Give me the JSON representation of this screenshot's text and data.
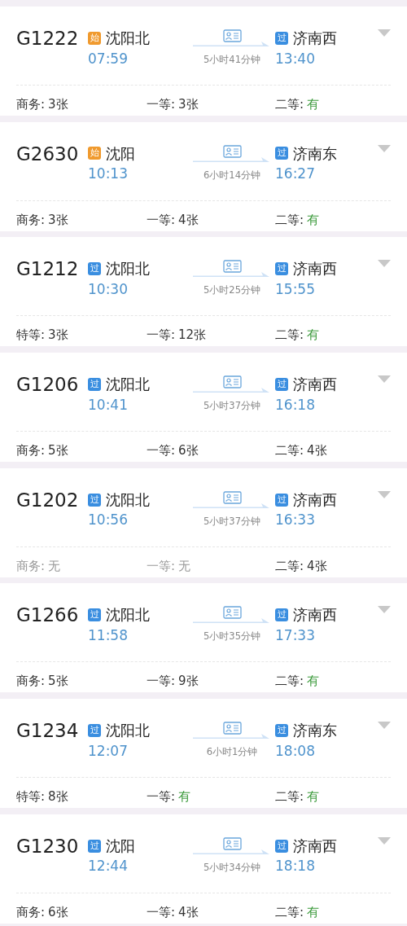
{
  "trains": [
    {
      "number": "G1222",
      "from": {
        "kind": "start",
        "badge": "始",
        "station": "沈阳北",
        "time": "07:59"
      },
      "duration": "5小时41分钟",
      "to": {
        "kind": "pass",
        "badge": "过",
        "station": "济南西",
        "time": "13:40"
      },
      "seats": [
        {
          "label": "商务:",
          "value": "3张",
          "kind": "count"
        },
        {
          "label": "一等:",
          "value": "3张",
          "kind": "count"
        },
        {
          "label": "二等:",
          "value": "有",
          "kind": "plenty"
        }
      ]
    },
    {
      "number": "G2630",
      "from": {
        "kind": "start",
        "badge": "始",
        "station": "沈阳",
        "time": "10:13"
      },
      "duration": "6小时14分钟",
      "to": {
        "kind": "pass",
        "badge": "过",
        "station": "济南东",
        "time": "16:27"
      },
      "seats": [
        {
          "label": "商务:",
          "value": "3张",
          "kind": "count"
        },
        {
          "label": "一等:",
          "value": "4张",
          "kind": "count"
        },
        {
          "label": "二等:",
          "value": "有",
          "kind": "plenty"
        }
      ]
    },
    {
      "number": "G1212",
      "from": {
        "kind": "pass",
        "badge": "过",
        "station": "沈阳北",
        "time": "10:30"
      },
      "duration": "5小时25分钟",
      "to": {
        "kind": "pass",
        "badge": "过",
        "station": "济南西",
        "time": "15:55"
      },
      "seats": [
        {
          "label": "特等:",
          "value": "3张",
          "kind": "count"
        },
        {
          "label": "一等:",
          "value": "12张",
          "kind": "count"
        },
        {
          "label": "二等:",
          "value": "有",
          "kind": "plenty"
        }
      ]
    },
    {
      "number": "G1206",
      "from": {
        "kind": "pass",
        "badge": "过",
        "station": "沈阳北",
        "time": "10:41"
      },
      "duration": "5小时37分钟",
      "to": {
        "kind": "pass",
        "badge": "过",
        "station": "济南西",
        "time": "16:18"
      },
      "seats": [
        {
          "label": "商务:",
          "value": "5张",
          "kind": "count"
        },
        {
          "label": "一等:",
          "value": "6张",
          "kind": "count"
        },
        {
          "label": "二等:",
          "value": "4张",
          "kind": "count"
        }
      ]
    },
    {
      "number": "G1202",
      "from": {
        "kind": "pass",
        "badge": "过",
        "station": "沈阳北",
        "time": "10:56"
      },
      "duration": "5小时37分钟",
      "to": {
        "kind": "pass",
        "badge": "过",
        "station": "济南西",
        "time": "16:33"
      },
      "seats": [
        {
          "label": "商务:",
          "value": "无",
          "kind": "none"
        },
        {
          "label": "一等:",
          "value": "无",
          "kind": "none"
        },
        {
          "label": "二等:",
          "value": "4张",
          "kind": "count"
        }
      ]
    },
    {
      "number": "G1266",
      "from": {
        "kind": "pass",
        "badge": "过",
        "station": "沈阳北",
        "time": "11:58"
      },
      "duration": "5小时35分钟",
      "to": {
        "kind": "pass",
        "badge": "过",
        "station": "济南西",
        "time": "17:33"
      },
      "seats": [
        {
          "label": "商务:",
          "value": "5张",
          "kind": "count"
        },
        {
          "label": "一等:",
          "value": "9张",
          "kind": "count"
        },
        {
          "label": "二等:",
          "value": "有",
          "kind": "plenty"
        }
      ]
    },
    {
      "number": "G1234",
      "from": {
        "kind": "pass",
        "badge": "过",
        "station": "沈阳北",
        "time": "12:07"
      },
      "duration": "6小时1分钟",
      "to": {
        "kind": "pass",
        "badge": "过",
        "station": "济南东",
        "time": "18:08"
      },
      "seats": [
        {
          "label": "特等:",
          "value": "8张",
          "kind": "count"
        },
        {
          "label": "一等:",
          "value": "有",
          "kind": "plenty"
        },
        {
          "label": "二等:",
          "value": "有",
          "kind": "plenty"
        }
      ]
    },
    {
      "number": "G1230",
      "from": {
        "kind": "pass",
        "badge": "过",
        "station": "沈阳",
        "time": "12:44"
      },
      "duration": "5小时34分钟",
      "to": {
        "kind": "pass",
        "badge": "过",
        "station": "济南西",
        "time": "18:18"
      },
      "seats": [
        {
          "label": "商务:",
          "value": "6张",
          "kind": "count"
        },
        {
          "label": "一等:",
          "value": "4张",
          "kind": "count"
        },
        {
          "label": "二等:",
          "value": "有",
          "kind": "plenty"
        }
      ]
    }
  ]
}
